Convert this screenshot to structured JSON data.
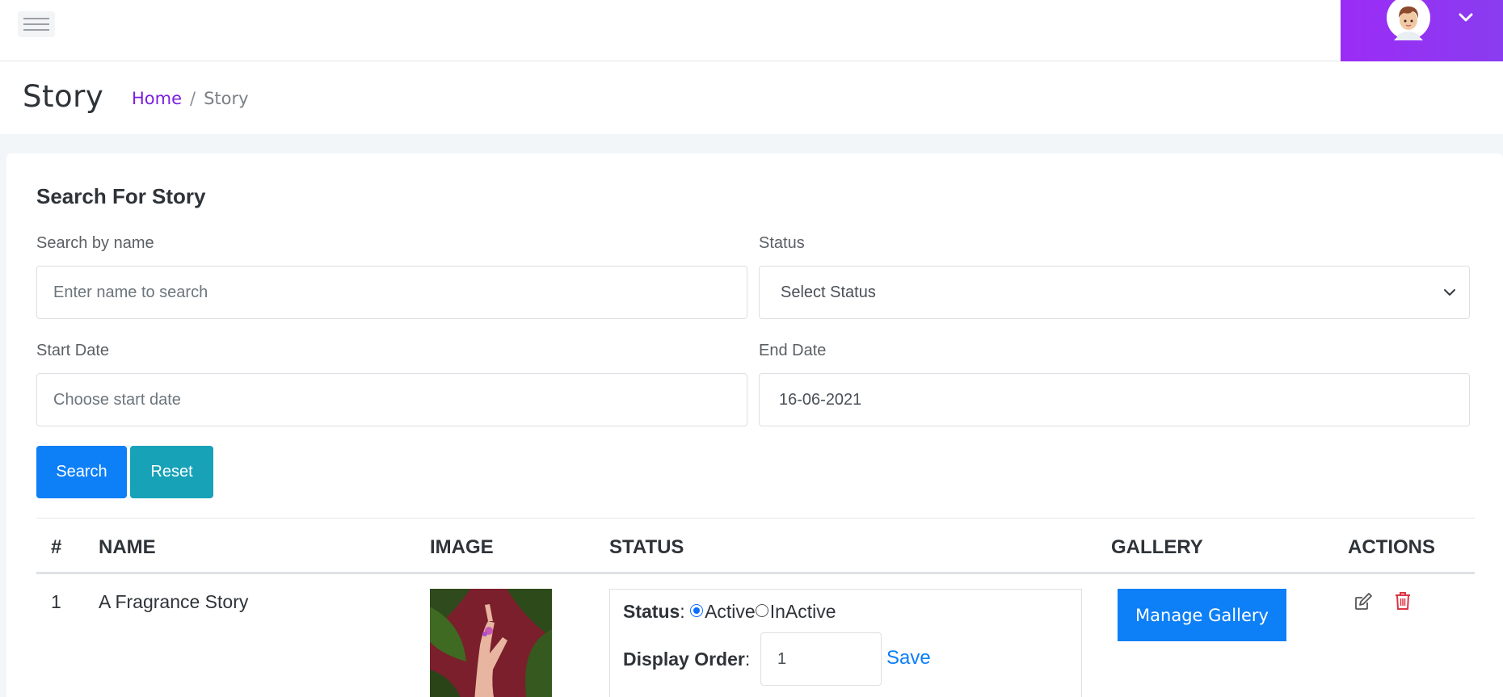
{
  "topbar": {
    "menu_icon": "hamburger-icon",
    "avatar_icon": "user-avatar-icon",
    "dropdown_icon": "chevron-down-icon",
    "accent_color": "#9b2cf5"
  },
  "header": {
    "title": "Story",
    "breadcrumb": {
      "home": "Home",
      "separator": "/",
      "current": "Story"
    }
  },
  "search": {
    "title": "Search For Story",
    "name_label": "Search by name",
    "name_placeholder": "Enter name to search",
    "status_label": "Status",
    "status_selected": "Select Status",
    "start_label": "Start Date",
    "start_placeholder": "Choose start date",
    "end_label": "End Date",
    "end_value": "16-06-2021",
    "search_button": "Search",
    "reset_button": "Reset"
  },
  "table": {
    "headers": [
      "#",
      "NAME",
      "IMAGE",
      "STATUS",
      "GALLERY",
      "ACTIONS"
    ],
    "rows": [
      {
        "index": "1",
        "name": "A Fragrance Story",
        "status_label": "Status",
        "status_options": [
          "Active",
          "InActive"
        ],
        "status_selected": "Active",
        "display_order_label": "Display Order",
        "display_order": "1",
        "save_label": "Save",
        "gallery_button": "Manage Gallery",
        "actions": [
          "edit-icon",
          "delete-icon"
        ]
      }
    ]
  }
}
